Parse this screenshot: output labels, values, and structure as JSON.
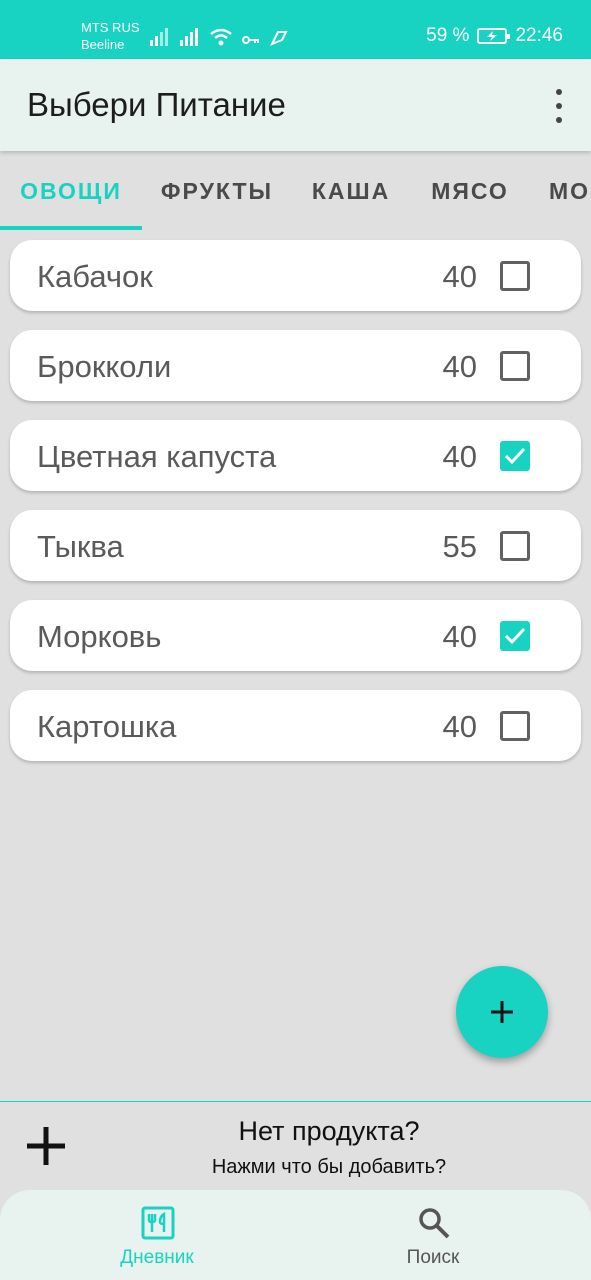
{
  "status_bar": {
    "carrier_1": "MTS RUS",
    "carrier_2": "Beeline",
    "battery": "59 %",
    "time": "22:46"
  },
  "app_bar": {
    "title": "Выбери Питание",
    "overflow_icon": "more-vert-icon"
  },
  "tabs": [
    {
      "label": "ОВОЩИ",
      "active": true
    },
    {
      "label": "ФРУКТЫ",
      "active": false
    },
    {
      "label": "КАША",
      "active": false
    },
    {
      "label": "МЯСО",
      "active": false
    },
    {
      "label": "МО",
      "active": false
    }
  ],
  "items": [
    {
      "name": "Кабачок",
      "value": "40",
      "checked": false
    },
    {
      "name": "Брокколи",
      "value": "40",
      "checked": false
    },
    {
      "name": "Цветная капуста",
      "value": "40",
      "checked": true
    },
    {
      "name": "Тыква",
      "value": "55",
      "checked": false
    },
    {
      "name": "Морковь",
      "value": "40",
      "checked": true
    },
    {
      "name": "Картошка",
      "value": "40",
      "checked": false
    }
  ],
  "add_banner": {
    "title": "Нет продукта?",
    "subtitle": "Нажми что бы добавить?"
  },
  "bottom_nav": [
    {
      "label": "Дневник",
      "icon": "restaurant-menu-icon",
      "active": true
    },
    {
      "label": "Поиск",
      "icon": "search-icon",
      "active": false
    }
  ],
  "colors": {
    "accent": "#18d3c2",
    "background": "#e0e0e0",
    "app_bar": "#e8f2ee"
  }
}
